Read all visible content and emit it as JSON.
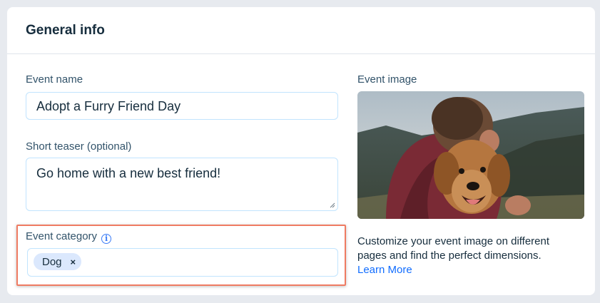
{
  "card": {
    "title": "General info"
  },
  "event_name": {
    "label": "Event name",
    "value": "Adopt a Furry Friend Day"
  },
  "short_teaser": {
    "label": "Short teaser (optional)",
    "value": "Go home with a new  best friend!"
  },
  "event_category": {
    "label": "Event category",
    "info_icon": "info-icon",
    "tags": [
      "Dog"
    ],
    "remove_icon": "×"
  },
  "event_image": {
    "label": "Event image",
    "image_subject": "man hugging golden dog outdoors, mountains in background",
    "help_text": "Customize your event image on different pages and find the perfect dimensions.",
    "link_text": "Learn More"
  },
  "colors": {
    "accent": "#116dff",
    "highlight": "#ef7b62",
    "tag_bg": "#dbe8fd"
  }
}
